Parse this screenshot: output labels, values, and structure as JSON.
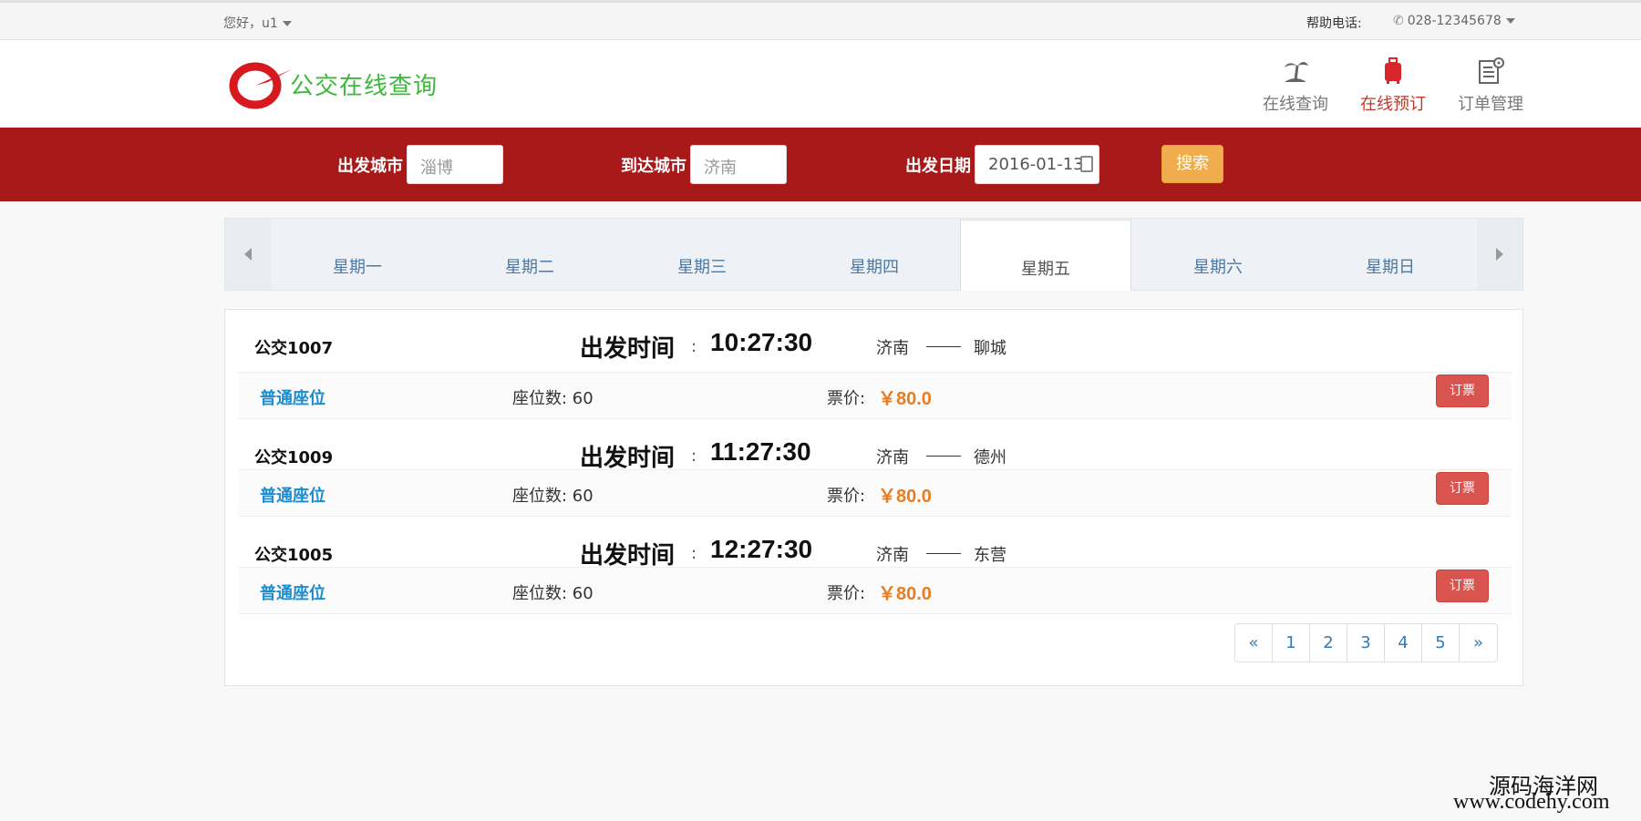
{
  "topbar": {
    "greeting": "您好，u1",
    "help_label": "帮助电话:",
    "phone": "028-12345678"
  },
  "header": {
    "brand": "公交在线查询",
    "nav": [
      {
        "label": "在线查询",
        "icon": "palm-island-icon"
      },
      {
        "label": "在线预订",
        "icon": "luggage-icon",
        "active": true
      },
      {
        "label": "订单管理",
        "icon": "order-settings-icon"
      }
    ]
  },
  "search": {
    "from_label": "出发城市",
    "from_placeholder": "淄博",
    "to_label": "到达城市",
    "to_placeholder": "济南",
    "date_label": "出发日期",
    "date_value": "2016-01-13",
    "button": "搜索"
  },
  "days": [
    "星期一",
    "星期二",
    "星期三",
    "星期四",
    "星期五",
    "星期六",
    "星期日"
  ],
  "active_day": "星期五",
  "results": [
    {
      "bus": "公交1007",
      "depart_label": "出发时间",
      "colon": ":",
      "time": "10:27:30",
      "from": "济南",
      "to": "聊城",
      "seat_type": "普通座位",
      "seats": "座位数: 60",
      "price_label": "票价:",
      "price": "￥80.0",
      "book": "订票"
    },
    {
      "bus": "公交1009",
      "depart_label": "出发时间",
      "colon": ":",
      "time": "11:27:30",
      "from": "济南",
      "to": "德州",
      "seat_type": "普通座位",
      "seats": "座位数: 60",
      "price_label": "票价:",
      "price": "￥80.0",
      "book": "订票"
    },
    {
      "bus": "公交1005",
      "depart_label": "出发时间",
      "colon": ":",
      "time": "12:27:30",
      "from": "济南",
      "to": "东营",
      "seat_type": "普通座位",
      "seats": "座位数: 60",
      "price_label": "票价:",
      "price": "￥80.0",
      "book": "订票"
    }
  ],
  "pagination": [
    "«",
    "1",
    "2",
    "3",
    "4",
    "5",
    "»"
  ],
  "watermark": {
    "line1": "源码海洋网",
    "line2": "www.codehy.com"
  },
  "colors": {
    "band": "#a8191a",
    "search_button": "#f0ad4e",
    "book_button": "#d9534f",
    "price": "#e87c20",
    "seat_type": "#1a8ccf",
    "brand_text": "#3cb83c"
  }
}
